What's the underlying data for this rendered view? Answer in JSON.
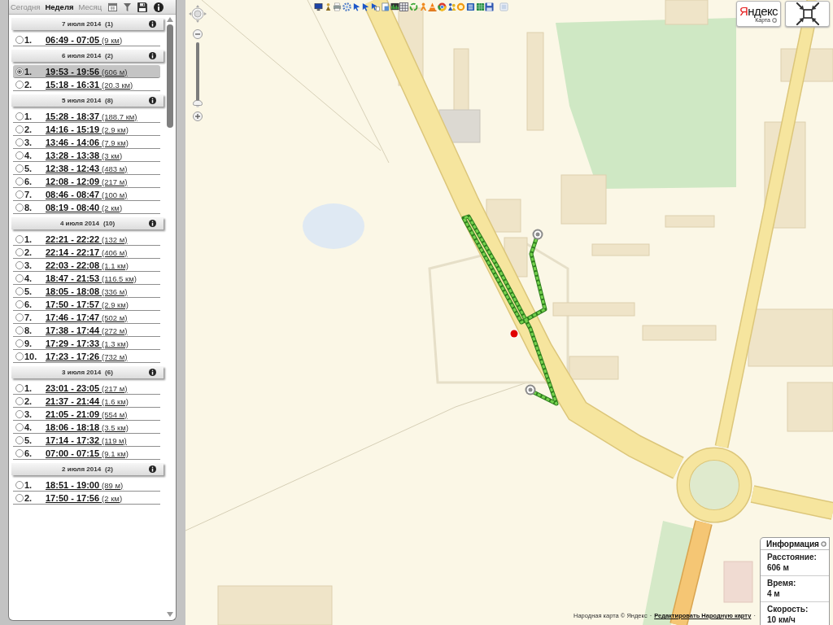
{
  "sidebar": {
    "tabs": [
      {
        "label": "Сегодня",
        "selected": false
      },
      {
        "label": "Неделя",
        "selected": true
      },
      {
        "label": "Месяц",
        "selected": false
      }
    ],
    "days": [
      {
        "title": "7 июля 2014",
        "count": "(1)",
        "trips": [
          {
            "number": "1.",
            "time": "06:49 - 07:05",
            "distance": "(9 км)",
            "selected": false
          }
        ]
      },
      {
        "title": "6 июля 2014",
        "count": "(2)",
        "trips": [
          {
            "number": "1.",
            "time": "19:53 - 19:56",
            "distance": "(606 м)",
            "selected": true
          },
          {
            "number": "2.",
            "time": "15:18 - 16:31",
            "distance": "(20.3 км)",
            "selected": false
          }
        ]
      },
      {
        "title": "5 июля 2014",
        "count": "(8)",
        "trips": [
          {
            "number": "1.",
            "time": "15:28 - 18:37",
            "distance": "(188.7 км)",
            "selected": false
          },
          {
            "number": "2.",
            "time": "14:16 - 15:19",
            "distance": "(2.9 км)",
            "selected": false
          },
          {
            "number": "3.",
            "time": "13:46 - 14:06",
            "distance": "(7.9 км)",
            "selected": false
          },
          {
            "number": "4.",
            "time": "13:28 - 13:38",
            "distance": "(3 км)",
            "selected": false
          },
          {
            "number": "5.",
            "time": "12:38 - 12:43",
            "distance": "(483 м)",
            "selected": false
          },
          {
            "number": "6.",
            "time": "12:08 - 12:09",
            "distance": "(217 м)",
            "selected": false
          },
          {
            "number": "7.",
            "time": "08:46 - 08:47",
            "distance": "(100 м)",
            "selected": false
          },
          {
            "number": "8.",
            "time": "08:19 - 08:40",
            "distance": "(2 км)",
            "selected": false
          }
        ]
      },
      {
        "title": "4 июля 2014",
        "count": "(10)",
        "trips": [
          {
            "number": "1.",
            "time": "22:21 - 22:22",
            "distance": "(132 м)",
            "selected": false
          },
          {
            "number": "2.",
            "time": "22:14 - 22:17",
            "distance": "(406 м)",
            "selected": false
          },
          {
            "number": "3.",
            "time": "22:03 - 22:08",
            "distance": "(1.1 км)",
            "selected": false
          },
          {
            "number": "4.",
            "time": "18:47 - 21:53",
            "distance": "(116.5 км)",
            "selected": false
          },
          {
            "number": "5.",
            "time": "18:05 - 18:08",
            "distance": "(336 м)",
            "selected": false
          },
          {
            "number": "6.",
            "time": "17:50 - 17:57",
            "distance": "(2.9 км)",
            "selected": false
          },
          {
            "number": "7.",
            "time": "17:46 - 17:47",
            "distance": "(502 м)",
            "selected": false
          },
          {
            "number": "8.",
            "time": "17:38 - 17:44",
            "distance": "(272 м)",
            "selected": false
          },
          {
            "number": "9.",
            "time": "17:29 - 17:33",
            "distance": "(1.3 км)",
            "selected": false
          },
          {
            "number": "10.",
            "time": "17:23 - 17:26",
            "distance": "(732 м)",
            "selected": false
          }
        ]
      },
      {
        "title": "3 июля 2014",
        "count": "(6)",
        "trips": [
          {
            "number": "1.",
            "time": "23:01 - 23:05",
            "distance": "(217 м)",
            "selected": false
          },
          {
            "number": "2.",
            "time": "21:37 - 21:44",
            "distance": "(1.6 км)",
            "selected": false
          },
          {
            "number": "3.",
            "time": "21:05 - 21:09",
            "distance": "(554 м)",
            "selected": false
          },
          {
            "number": "4.",
            "time": "18:06 - 18:18",
            "distance": "(3.5 км)",
            "selected": false
          },
          {
            "number": "5.",
            "time": "17:14 - 17:32",
            "distance": "(119 м)",
            "selected": false
          },
          {
            "number": "6.",
            "time": "07:00 - 07:15",
            "distance": "(9.1 км)",
            "selected": false
          }
        ]
      },
      {
        "title": "2 июля 2014",
        "count": "(2)",
        "trips": [
          {
            "number": "1.",
            "time": "18:51 - 19:00",
            "distance": "(89 м)",
            "selected": false
          },
          {
            "number": "2.",
            "time": "17:50 - 17:56",
            "distance": "(2 км)",
            "selected": false
          }
        ]
      }
    ]
  },
  "map": {
    "zoom": {
      "level": 0.94
    },
    "logo": {
      "name": "Яндекс",
      "caption": "Карта"
    },
    "info_panel": {
      "title": "Информация",
      "fields": [
        {
          "label": "Расстояние:",
          "value": "606 м"
        },
        {
          "label": "Время:",
          "value": "4 м"
        },
        {
          "label": "Скорость:",
          "value": "10 км/ч"
        }
      ]
    },
    "attribution": [
      {
        "kind": "text",
        "label": "Народная карта © Яндекс"
      },
      {
        "kind": "separator",
        "label": "·"
      },
      {
        "kind": "link",
        "label": "Редактировать Народную карту"
      },
      {
        "kind": "separator",
        "label": "·"
      }
    ]
  }
}
